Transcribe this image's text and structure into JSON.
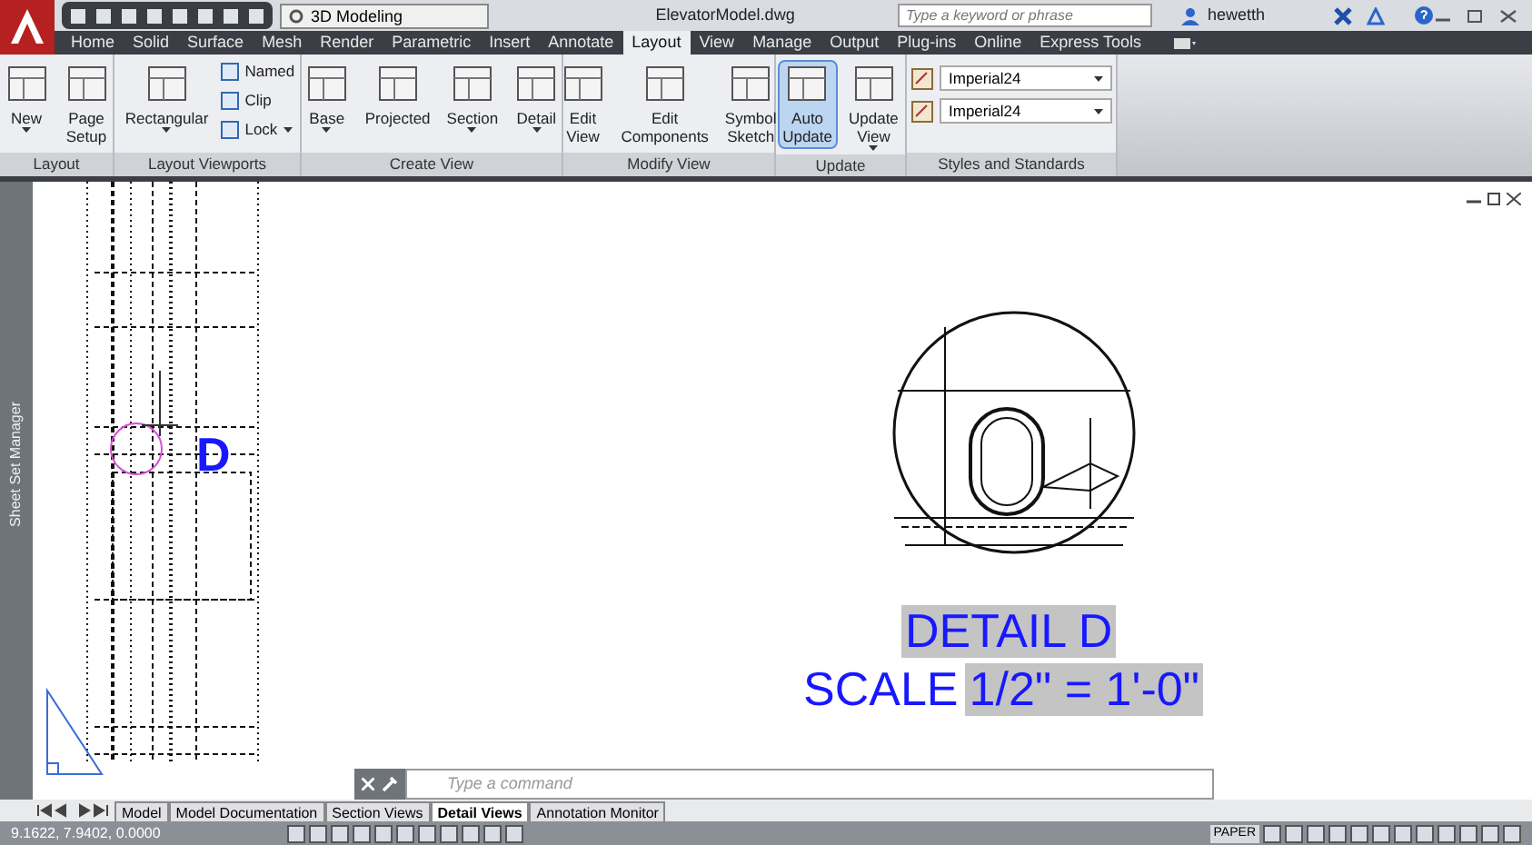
{
  "quick_access": {
    "workspace": "3D Modeling"
  },
  "title": "ElevatorModel.dwg",
  "search": {
    "placeholder": "Type a keyword or phrase"
  },
  "user": "hewetth",
  "ribbon_tabs": [
    {
      "label": "Home",
      "selected": false
    },
    {
      "label": "Solid",
      "selected": false
    },
    {
      "label": "Surface",
      "selected": false
    },
    {
      "label": "Mesh",
      "selected": false
    },
    {
      "label": "Render",
      "selected": false
    },
    {
      "label": "Parametric",
      "selected": false
    },
    {
      "label": "Insert",
      "selected": false
    },
    {
      "label": "Annotate",
      "selected": false
    },
    {
      "label": "Layout",
      "selected": true
    },
    {
      "label": "View",
      "selected": false
    },
    {
      "label": "Manage",
      "selected": false
    },
    {
      "label": "Output",
      "selected": false
    },
    {
      "label": "Plug-ins",
      "selected": false
    },
    {
      "label": "Online",
      "selected": false
    },
    {
      "label": "Express Tools",
      "selected": false
    }
  ],
  "panels": [
    {
      "title": "Layout",
      "items": [
        {
          "kind": "large",
          "label": "New",
          "dropdown": true,
          "selected": false
        },
        {
          "kind": "large",
          "label": "Page Setup",
          "dropdown": false,
          "selected": false
        }
      ]
    },
    {
      "title": "Layout Viewports",
      "items": [
        {
          "kind": "large",
          "label": "Rectangular",
          "dropdown": true,
          "selected": false
        },
        {
          "kind": "small",
          "label": "Named",
          "dropdown": false
        },
        {
          "kind": "small",
          "label": "Clip",
          "dropdown": false
        },
        {
          "kind": "small",
          "label": "Lock",
          "dropdown": true
        }
      ]
    },
    {
      "title": "Create View",
      "items": [
        {
          "kind": "large",
          "label": "Base",
          "dropdown": true,
          "selected": false
        },
        {
          "kind": "large",
          "label": "Projected",
          "dropdown": false,
          "selected": false
        },
        {
          "kind": "large",
          "label": "Section",
          "dropdown": true,
          "selected": false
        },
        {
          "kind": "large",
          "label": "Detail",
          "dropdown": true,
          "selected": false
        }
      ]
    },
    {
      "title": "Modify View",
      "items": [
        {
          "kind": "large",
          "label": "Edit View",
          "dropdown": false,
          "selected": false
        },
        {
          "kind": "large",
          "label": "Edit Components",
          "dropdown": false,
          "selected": false
        },
        {
          "kind": "large",
          "label": "Symbol Sketch",
          "dropdown": false,
          "selected": false
        }
      ]
    },
    {
      "title": "Update",
      "items": [
        {
          "kind": "large",
          "label": "Auto Update",
          "dropdown": false,
          "selected": true
        },
        {
          "kind": "large",
          "label": "Update View",
          "dropdown": true,
          "selected": false
        }
      ]
    },
    {
      "title": "Styles and Standards",
      "items": [
        {
          "kind": "select",
          "value": "Imperial24"
        },
        {
          "kind": "select",
          "value": "Imperial24"
        }
      ]
    }
  ],
  "sheet_set_manager": "Sheet Set Manager",
  "drawing": {
    "marker_letter": "D",
    "detail_label": {
      "text": "DETAIL D",
      "highlighted": true
    },
    "scale_prefix": {
      "text": "SCALE",
      "highlighted": false
    },
    "scale_value": {
      "text": "1/2\" = 1'-0\"",
      "highlighted": true
    }
  },
  "command_line": {
    "placeholder": "Type a command"
  },
  "layout_tabs": [
    {
      "label": "Model",
      "selected": false
    },
    {
      "label": "Model Documentation",
      "selected": false
    },
    {
      "label": "Section Views",
      "selected": false
    },
    {
      "label": "Detail Views",
      "selected": true
    },
    {
      "label": "Annotation Monitor",
      "selected": false
    }
  ],
  "status": {
    "coordinates": "9.1622, 7.9402, 0.0000",
    "space": "PAPER"
  }
}
